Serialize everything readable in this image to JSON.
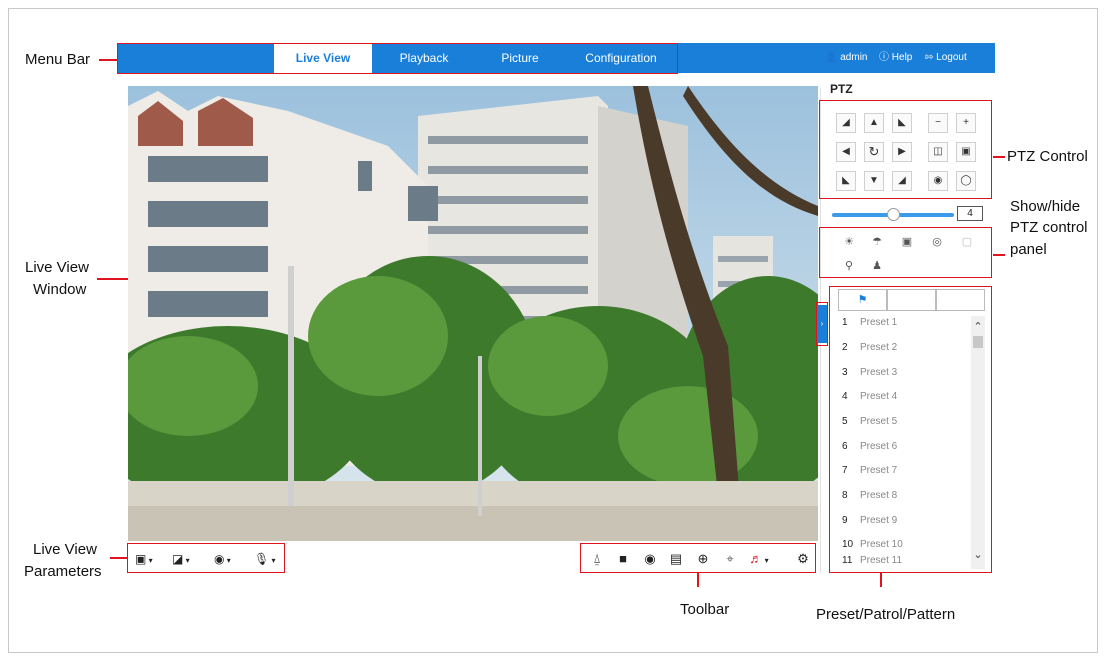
{
  "menubar": {
    "tabs": [
      {
        "label": "Live View",
        "active": true
      },
      {
        "label": "Playback",
        "active": false
      },
      {
        "label": "Picture",
        "active": false
      },
      {
        "label": "Configuration",
        "active": false
      }
    ],
    "user": "admin",
    "help": "Help",
    "logout": "Logout"
  },
  "ptz": {
    "title": "PTZ",
    "speed": "4",
    "speed_level": 0.5
  },
  "presets": [
    {
      "num": "1",
      "name": "Preset 1"
    },
    {
      "num": "2",
      "name": "Preset 2"
    },
    {
      "num": "3",
      "name": "Preset 3"
    },
    {
      "num": "4",
      "name": "Preset 4"
    },
    {
      "num": "5",
      "name": "Preset 5"
    },
    {
      "num": "6",
      "name": "Preset 6"
    },
    {
      "num": "7",
      "name": "Preset 7"
    },
    {
      "num": "8",
      "name": "Preset 8"
    },
    {
      "num": "9",
      "name": "Preset 9"
    },
    {
      "num": "10",
      "name": "Preset 10"
    },
    {
      "num": "11",
      "name": "Preset 11"
    }
  ],
  "annotations": {
    "menu_bar": "Menu Bar",
    "live_view_window_1": "Live View",
    "live_view_window_2": "Window",
    "live_view_params_1": "Live View",
    "live_view_params_2": "Parameters",
    "ptz_control": "PTZ Control",
    "show_hide_1": "Show/hide",
    "show_hide_2": "PTZ control",
    "show_hide_3": "panel",
    "toolbar": "Toolbar",
    "preset_patrol_pattern": "Preset/Patrol/Pattern"
  },
  "colors": {
    "menubar": "#1a7fd9",
    "annotation_red": "#e0141e"
  }
}
